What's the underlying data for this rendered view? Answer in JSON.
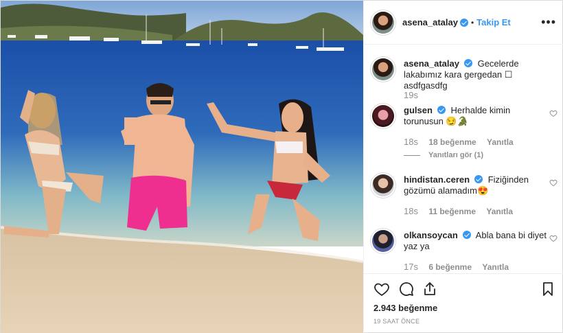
{
  "post": {
    "username": "asena_atalay",
    "follow_label": "Takip Et",
    "dot": "•",
    "more": "•••"
  },
  "caption": {
    "username": "asena_atalay",
    "text": "Gecelerde lakabımız kara gergedan ☐ asdfgasdfg",
    "time": "19s"
  },
  "comments": [
    {
      "username": "gulsen",
      "text": "Herhalde kimin torunusun 😏🐊",
      "time": "18s",
      "likes": "18 beğenme",
      "reply": "Yanıtla",
      "view_replies": "Yanıtları gör (1)"
    },
    {
      "username": "hindistan.ceren",
      "text": "Fiziğinden gözümü alamadım😍",
      "time": "18s",
      "likes": "11 beğenme",
      "reply": "Yanıtla"
    },
    {
      "username": "olkansoycan",
      "text": "Abla bana bi diyet yaz ya",
      "time": "17s",
      "likes": "6 beğenme",
      "reply": "Yanıtla"
    }
  ],
  "footer": {
    "likes": "2.943 beğenme",
    "time_ago": "19 SAAT ÖNCE"
  },
  "icons": [
    "heart-icon",
    "comment-icon",
    "share-icon",
    "bookmark-icon",
    "more-icon",
    "verified-icon"
  ],
  "colors": {
    "link": "#3897f0",
    "muted": "#8e8e8e",
    "text": "#262626",
    "border": "#efefef"
  }
}
